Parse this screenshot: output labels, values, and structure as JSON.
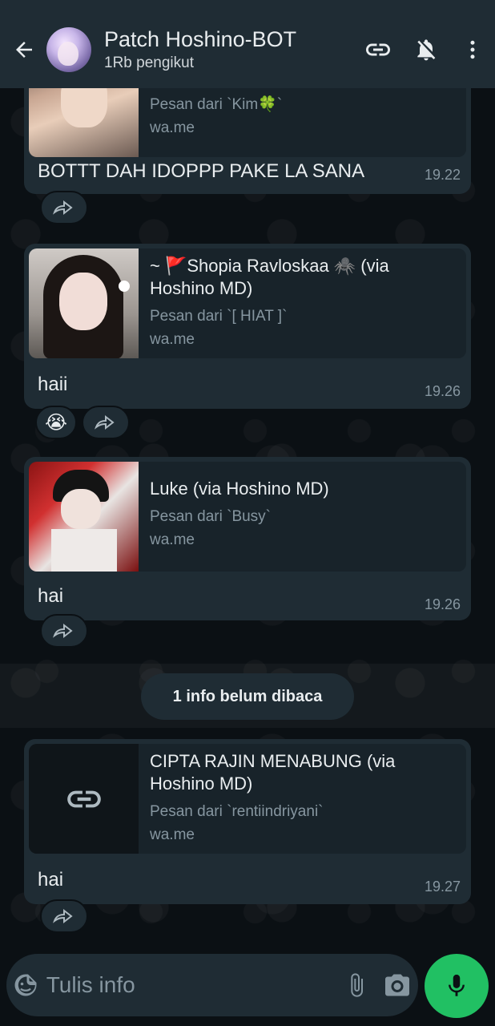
{
  "header": {
    "back_icon": "arrow-left-icon",
    "title": "Patch Hoshino-BOT",
    "subtitle": "1Rb pengikut",
    "icons": [
      "link-icon",
      "bell-off-icon",
      "more-vert-icon"
    ]
  },
  "messages": [
    {
      "card_subtitle": "Pesan dari `Kim🍀`",
      "card_link": "wa.me",
      "text": "BOTTT DAH IDOPPP PAKE LA SANA",
      "time": "19.22"
    },
    {
      "card_title": "~ 🚩Shopia Ravloskaa 🕷️ (via Hoshino MD)",
      "card_subtitle": "Pesan dari `[ HIAT ]`",
      "card_link": "wa.me",
      "text": "haii",
      "time": "19.26",
      "reaction": "😭"
    },
    {
      "card_title": "Luke (via Hoshino MD)",
      "card_subtitle": "Pesan dari `Busy`",
      "card_link": "wa.me",
      "text": "hai",
      "time": "19.26"
    },
    {
      "card_title": "CIPTA RAJIN MENABUNG (via Hoshino MD)",
      "card_subtitle": "Pesan dari `rentiindriyani`",
      "card_link": "wa.me",
      "text": "hai",
      "time": "19.27"
    }
  ],
  "unread_divider": "1 info belum dibaca",
  "composer": {
    "placeholder": "Tulis info",
    "icons": [
      "sticker-icon",
      "attach-icon",
      "camera-icon",
      "mic-icon"
    ]
  },
  "colors": {
    "background": "#0b1014",
    "bar": "#1f2c34",
    "bubble": "#1f2c34",
    "accent": "#21c063",
    "muted_text": "#8696a0"
  }
}
